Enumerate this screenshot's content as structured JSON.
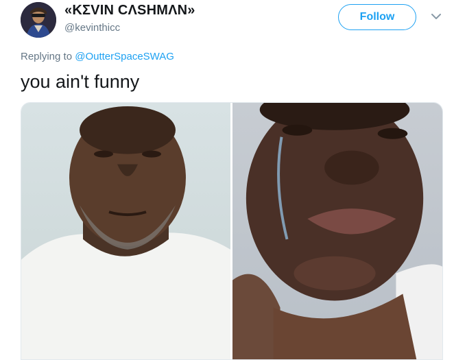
{
  "user": {
    "display_name": "«KΣVIN CΛSHMΛN»",
    "handle": "@kevinthicc"
  },
  "actions": {
    "follow_label": "Follow"
  },
  "reply": {
    "prefix": "Replying to ",
    "mention": "@OutterSpaceSWAG"
  },
  "tweet": {
    "text": "you ain't funny"
  },
  "colors": {
    "accent": "#1da1f2",
    "muted": "#657786",
    "text": "#14171a"
  },
  "icons": {
    "caret": "chevron-down-icon"
  }
}
